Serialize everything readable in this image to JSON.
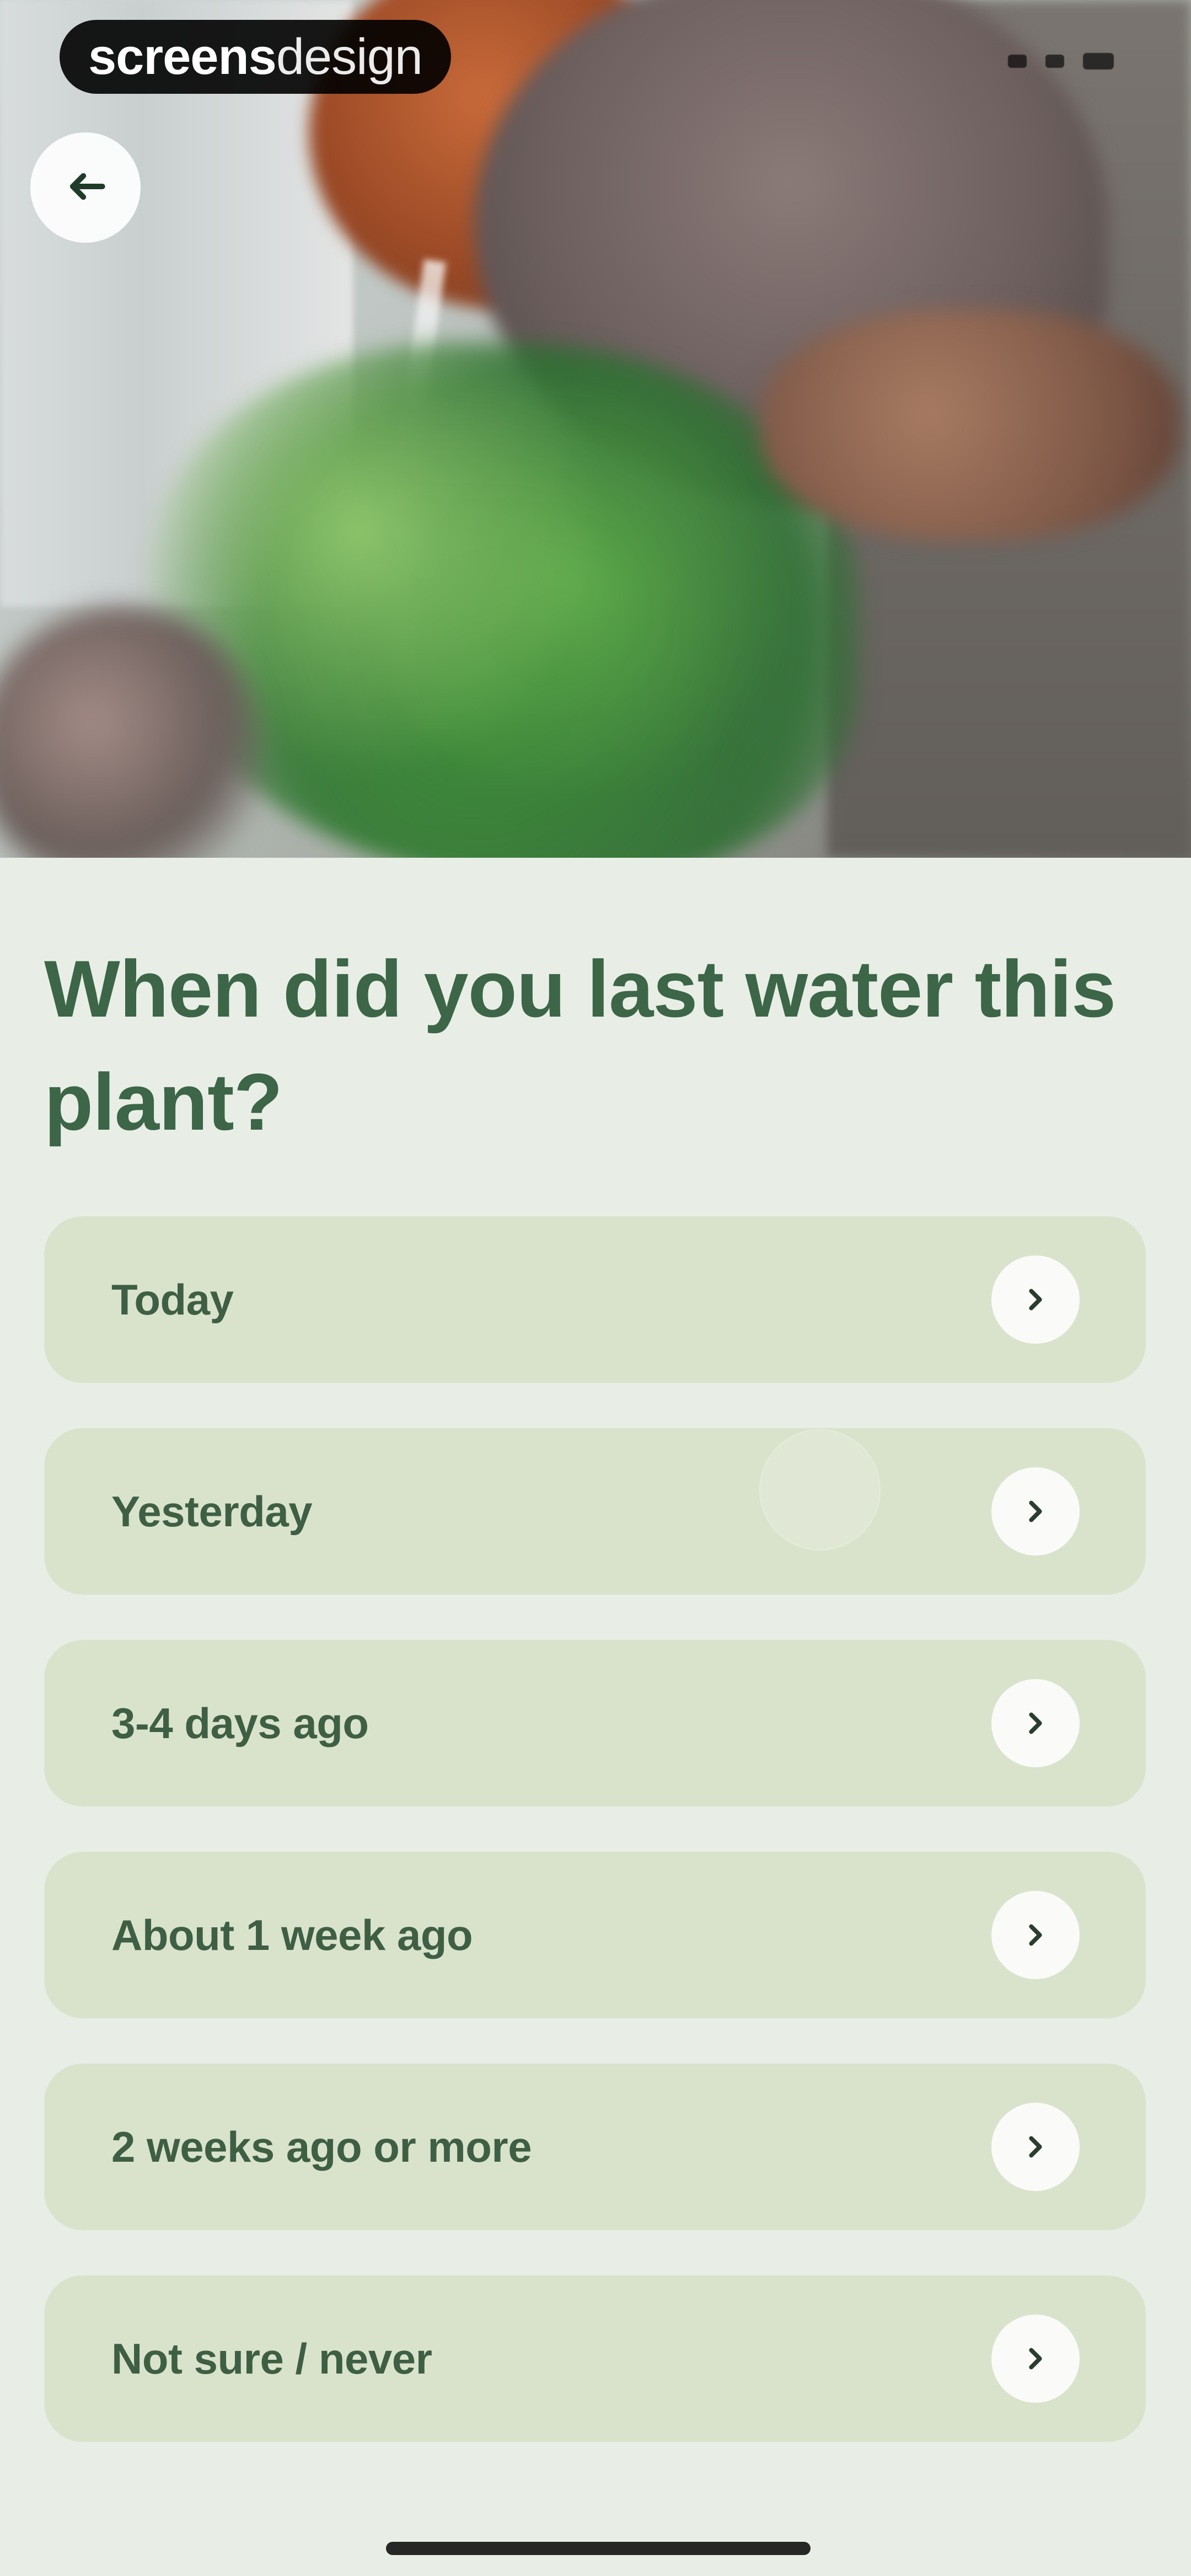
{
  "watermark": {
    "bold": "screens",
    "light": "design"
  },
  "header": {
    "back_icon": "arrow-left-icon"
  },
  "question": {
    "text": "When did you last water this plant?"
  },
  "options": [
    {
      "label": "Today",
      "icon": "chevron-right-icon"
    },
    {
      "label": "Yesterday",
      "icon": "chevron-right-icon"
    },
    {
      "label": "3-4 days ago",
      "icon": "chevron-right-icon"
    },
    {
      "label": "About 1 week ago",
      "icon": "chevron-right-icon"
    },
    {
      "label": "2 weeks ago or more",
      "icon": "chevron-right-icon"
    },
    {
      "label": "Not sure / never",
      "icon": "chevron-right-icon"
    }
  ],
  "colors": {
    "background": "#e8eee6",
    "question_text": "#3c6647",
    "option_bg": "#d9e3cc",
    "option_text": "#3f5f45"
  }
}
